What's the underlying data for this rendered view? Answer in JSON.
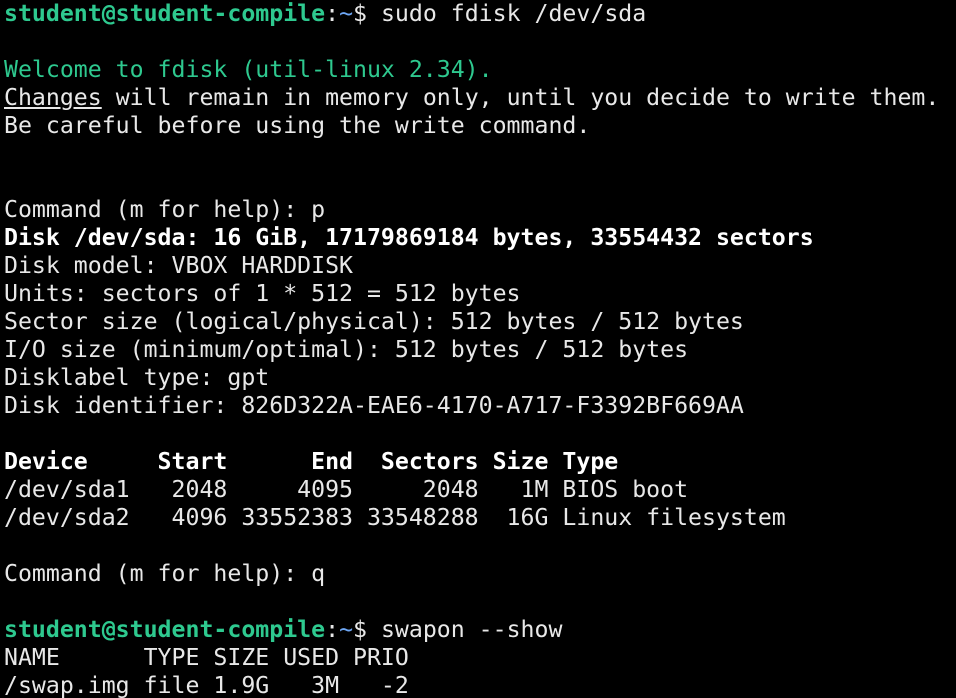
{
  "prompt": {
    "user_host": "student@student-compile",
    "colon": ":",
    "path": "~",
    "dollar": "$ "
  },
  "commands": {
    "fdisk": "sudo fdisk /dev/sda",
    "swapon": "swapon --show"
  },
  "fdisk_intro": {
    "welcome": "Welcome to fdisk (util-linux 2.34).",
    "changes_word": "Changes",
    "changes_rest": " will remain in memory only, until you decide to write them.",
    "careful": "Be careful before using the write command."
  },
  "fdisk_session": {
    "command_p": "Command (m for help): p",
    "disk_header": "Disk /dev/sda: 16 GiB, 17179869184 bytes, 33554432 sectors",
    "disk_model": "Disk model: VBOX HARDDISK",
    "units": "Units: sectors of 1 * 512 = 512 bytes",
    "sector_size": "Sector size (logical/physical): 512 bytes / 512 bytes",
    "io_size": "I/O size (minimum/optimal): 512 bytes / 512 bytes",
    "disklabel": "Disklabel type: gpt",
    "disk_identifier": "Disk identifier: 826D322A-EAE6-4170-A717-F3392BF669AA",
    "partition_header": "Device     Start      End  Sectors Size Type",
    "partitions": [
      "/dev/sda1   2048     4095     2048   1M BIOS boot",
      "/dev/sda2   4096 33552383 33548288  16G Linux filesystem"
    ],
    "command_q": "Command (m for help): q"
  },
  "swap": {
    "header": "NAME      TYPE SIZE USED PRIO",
    "rows": [
      "/swap.img file 1.9G   3M   -2"
    ]
  },
  "colors": {
    "background": "#000000",
    "text": "#e8e8e8",
    "prompt_user": "#2ec98f",
    "prompt_path": "#6ea7f5",
    "welcome": "#2ec98f"
  }
}
